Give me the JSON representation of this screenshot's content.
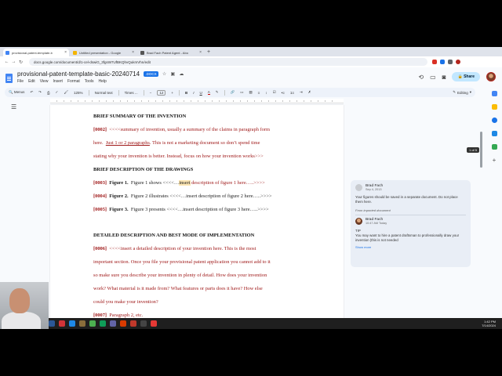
{
  "browser": {
    "tabs": [
      {
        "label": "provisional-patent-template-b",
        "active": true,
        "color": "#4285f4"
      },
      {
        "label": "Untitled presentation - Google",
        "active": false,
        "color": "#f4b400"
      },
      {
        "label": "Brad Fach Patent Agent - Abo",
        "active": false,
        "color": "#555555"
      }
    ],
    "new_tab": "+",
    "url": "docs.google.com/document/d/1-cel-dswiG_3fgsW7UfBKQhvQukmVhn/edit"
  },
  "docs": {
    "title": "provisional-patent-template-basic-20240714",
    "badge": ".DOCX",
    "menu": [
      "File",
      "Edit",
      "View",
      "Insert",
      "Format",
      "Tools",
      "Help"
    ],
    "share_label": "Share"
  },
  "toolbar": {
    "menus_label": "Menus",
    "zoom": "125%",
    "style": "Normal text",
    "font": "Times ...",
    "size": "12",
    "bold": "B",
    "italic": "I",
    "underline": "U",
    "text_color": "A",
    "mode": "Editing"
  },
  "document": {
    "h1": "BRIEF SUMMARY OF THE INVENTION",
    "p2_num": "[0002]",
    "p2_l1": "<<<<summary of invention, usually a summary of the claims in paragraph form",
    "p2_l2a": "here.",
    "p2_l2b": "Just 1 or 2 paragraphs",
    "p2_l2c": ".  This is not a marketing document so don’t spend time",
    "p2_l3": "stating why your invention is better.  Instead, focus on how your invention works>>>",
    "h2": "BRIEF DESCRIPTION OF THE DRAWINGS",
    "p3_num": "[0003]",
    "p3_fig": "Figure 1.",
    "p3_a": "Figure 1 shows <<<<…",
    "p3_hl": "insert",
    "p3_b": " description of figure 1 here…..>>>>",
    "p4_num": "[0004]",
    "p4_fig": "Figure 2.",
    "p4_a": "Figure 2 illustrates <<<<…insert description of figure 2 here…..>>>>",
    "p5_num": "[0005]",
    "p5_fig": "Figure 3.",
    "p5_a": "Figure 3 presents <<<<…insert description of figure 3 here…..>>>>",
    "h3": "DETAILED DESCRIPTION AND BEST MODE OF IMPLEMENTATION",
    "p6_num": "[0006]",
    "p6_l1": "<<<<insert a detailed description of your invention here.  This is the most",
    "p6_l2": "important section.  Once you file your provisional patent application you cannot add to it",
    "p6_l3": "so make sure you describe your invention in plenty of detail.  How does your invention",
    "p6_l4": "work?  What material is it made from?  What features or parts does it have?  How else",
    "p6_l5": "could you make your invention?",
    "p7_num": "[0007]",
    "p7_a": "Paragraph 2, etc."
  },
  "page_indicator": "1 of 5",
  "comment": {
    "author1": "Brad Fach",
    "date1": "Sep 4, 2013",
    "body1": "Your figures should be saved in a separate document. Do not place them here.",
    "from": "From imported document",
    "author2": "Brad Fach",
    "date2": "10:47 AM Today",
    "tip": "TIP",
    "body2": "You may want to hire a patent draftsman to professionally draw your invention (this is not needed",
    "more": "Show more"
  },
  "taskbar": {
    "time": "1:42 PM",
    "date": "7/14/2024",
    "icons": [
      "#2b5797",
      "#d13438",
      "#1e88e5",
      "#8a6d3b",
      "#4caf50",
      "#0f9d58",
      "#6264a7",
      "#d83b01",
      "#c0392b",
      "#444444",
      "#e53935"
    ]
  }
}
